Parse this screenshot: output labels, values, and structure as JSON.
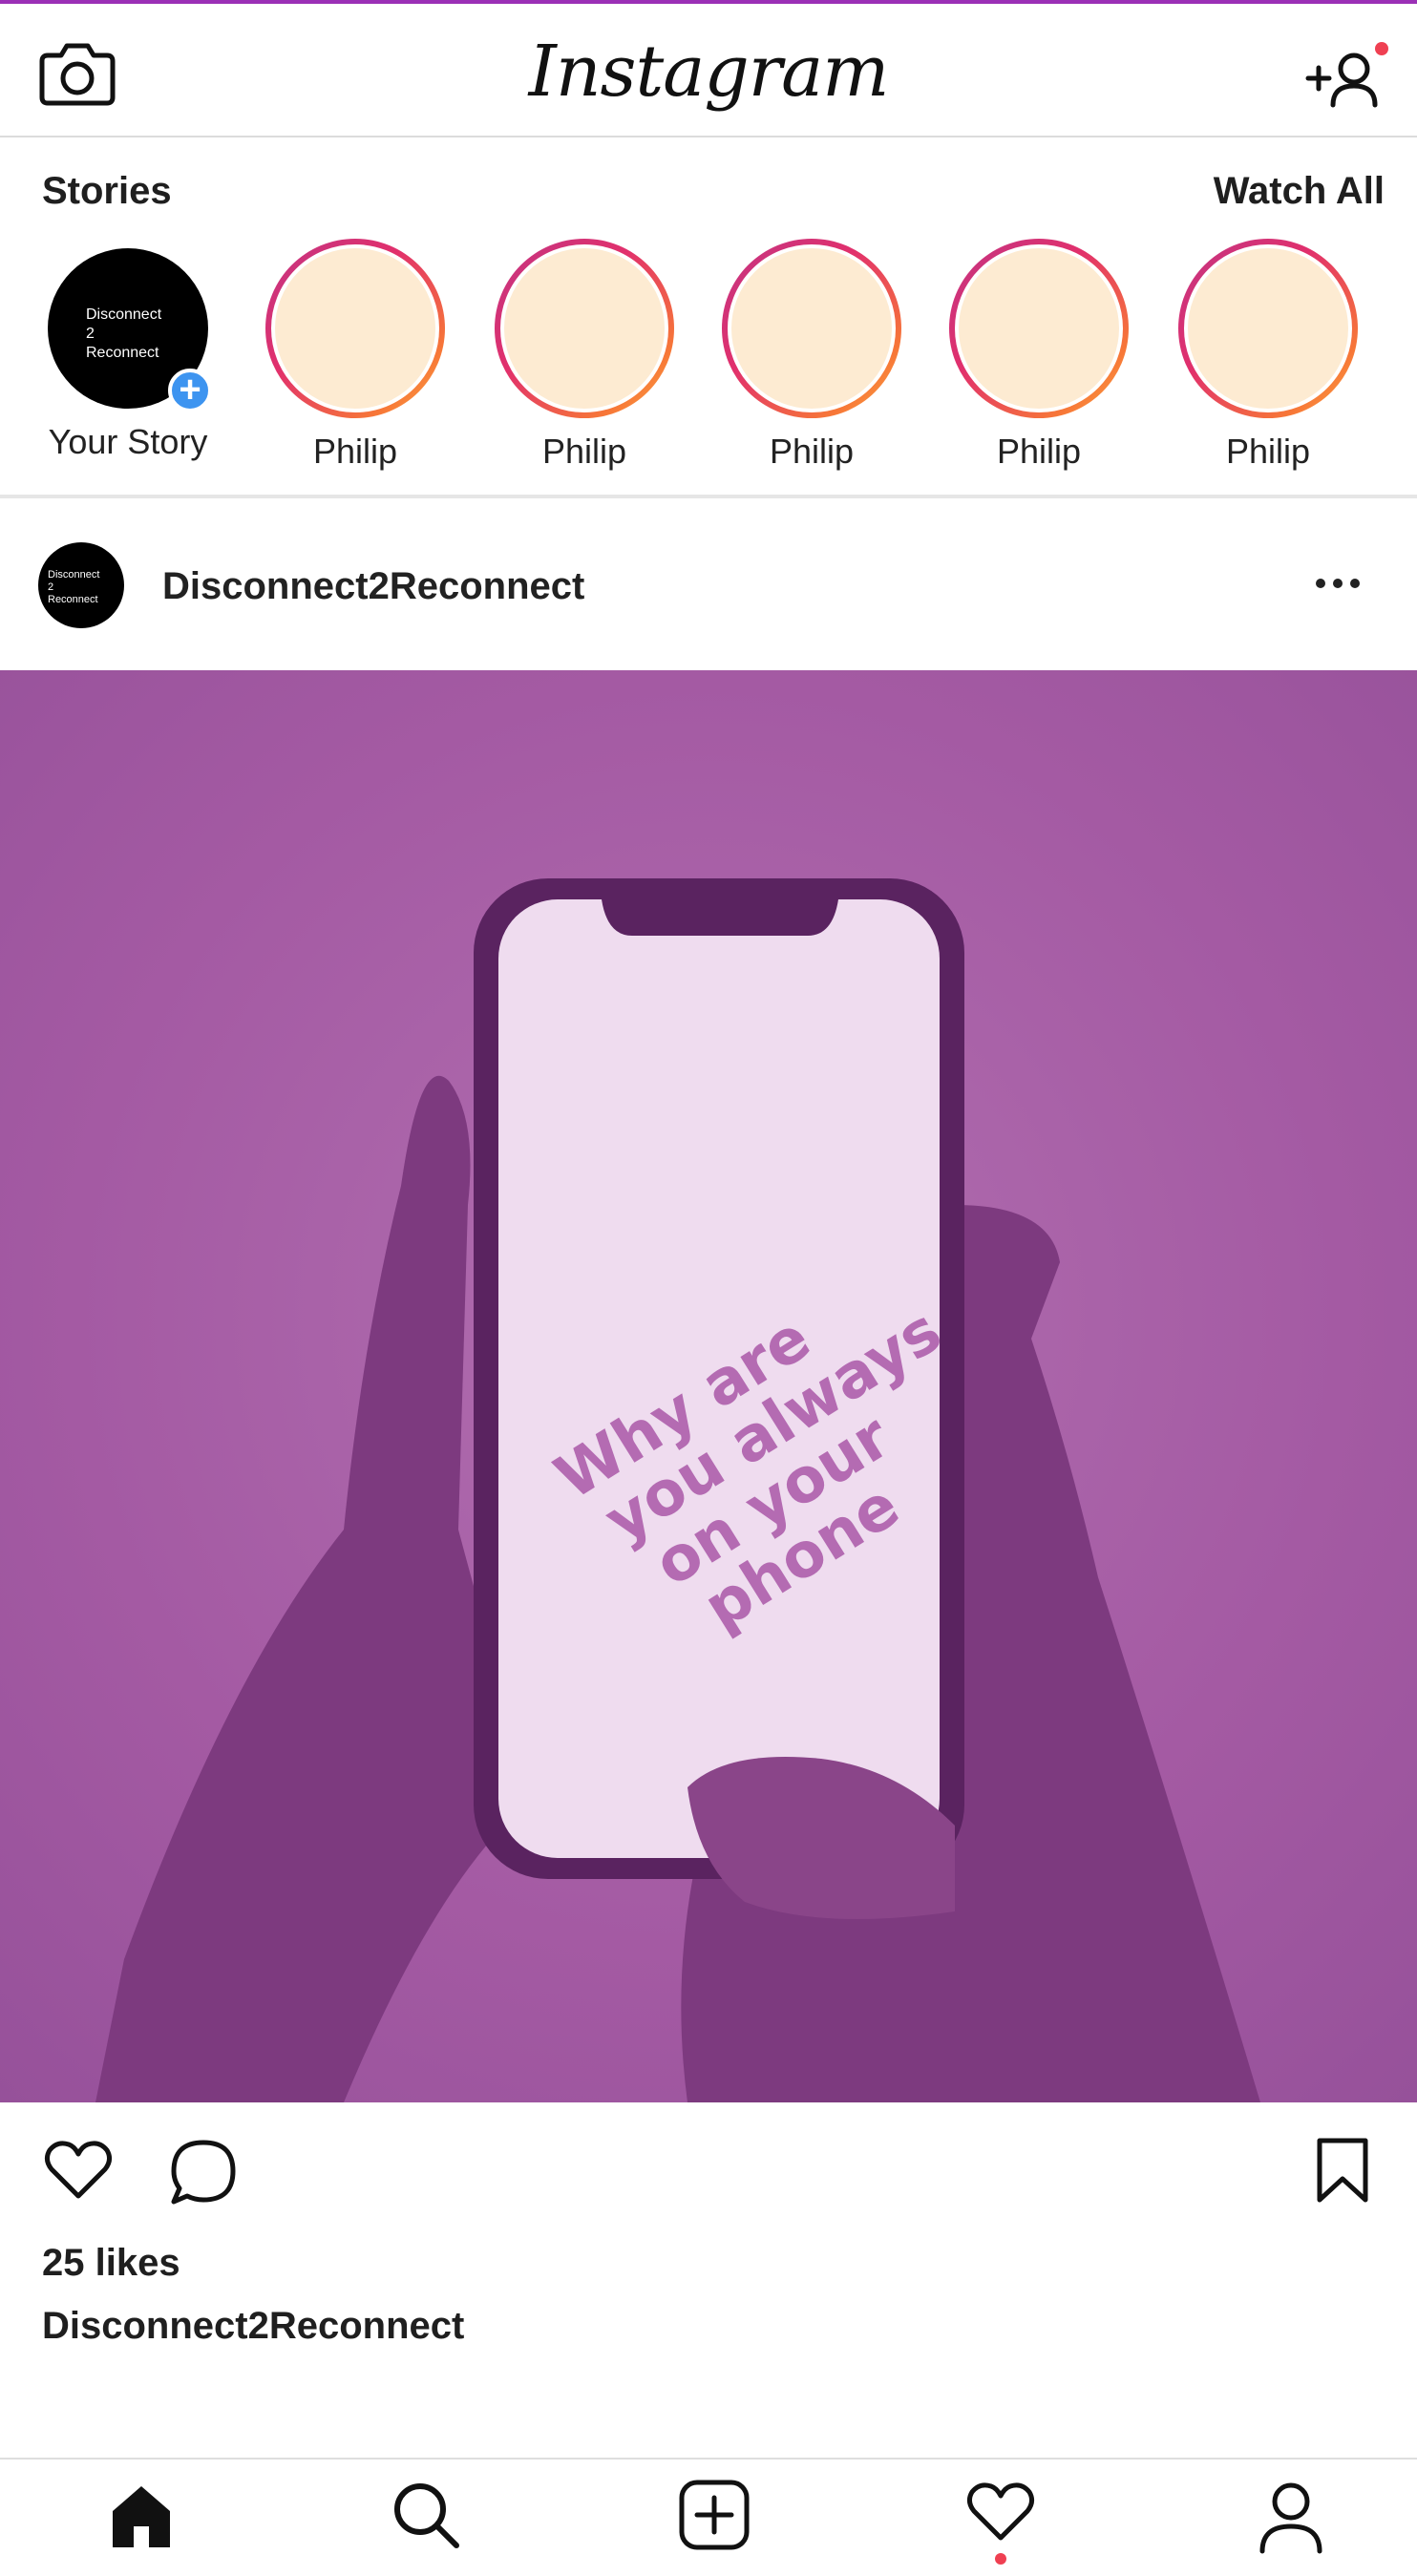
{
  "header": {
    "logo_text": "Instagram"
  },
  "stories": {
    "title": "Stories",
    "watch_all": "Watch All",
    "my_story": {
      "label": "Your Story",
      "avatar_text": [
        "Disconnect",
        "2",
        "Reconnect"
      ]
    },
    "items": [
      {
        "name": "Philip"
      },
      {
        "name": "Philip"
      },
      {
        "name": "Philip"
      },
      {
        "name": "Philip"
      },
      {
        "name": "Philip"
      }
    ]
  },
  "post": {
    "username": "Disconnect2Reconnect",
    "avatar_text": [
      "Disconnect",
      "2",
      "Reconnect"
    ],
    "image_text": [
      "Why are",
      "you always",
      "on your",
      "phone"
    ],
    "likes": "25 likes",
    "caption_username": "Disconnect2Reconnect"
  },
  "colors": {
    "accent_top": "#9b30b6",
    "notification": "#ef4052",
    "story_fill": "#fdebd2",
    "image_purple": "#a45aa3",
    "add_story_blue": "#3d94f0"
  },
  "icons": {
    "camera": "camera-icon",
    "add_user": "add-user-icon",
    "more": "more-options-icon",
    "like": "heart-icon",
    "comment": "comment-icon",
    "save": "bookmark-icon",
    "home": "home-icon",
    "search": "search-icon",
    "create": "plus-square-icon",
    "activity": "heart-icon",
    "profile": "profile-icon"
  }
}
